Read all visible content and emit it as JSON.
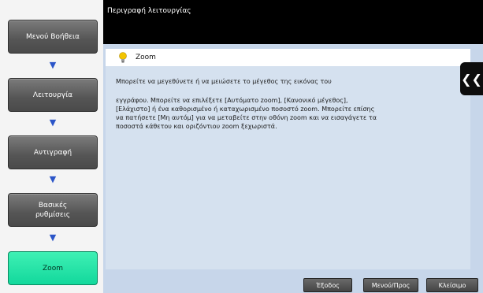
{
  "topbar": {
    "title": "Περιγραφή λειτουργίας"
  },
  "breadcrumb": {
    "items": [
      {
        "label": "Μενού Βοήθεια"
      },
      {
        "label": "Λειτουργία"
      },
      {
        "label": "Αντιγραφή"
      },
      {
        "label": "Βασικές ρυθμίσεις"
      },
      {
        "label": "Zoom"
      }
    ]
  },
  "panel": {
    "title": "Zoom",
    "paragraph1": "Μπορείτε να μεγεθύνετε ή να μειώσετε το μέγεθος της εικόνας του",
    "paragraph2": "εγγράφου. Μπορείτε να επιλέξετε [Αυτόματο zoom], [Κανονικό μέγεθος], [Ελάχιστο] ή ένα καθορισμένο ή καταχωρισμένο ποσοστό zoom. Μπορείτε επίσης να πατήσετε [Μη αυτόμ] για να μεταβείτε στην οθόνη zoom και να εισαγάγετε τα ποσοστά κάθετου και οριζόντιου zoom ξεχωριστά."
  },
  "footer": {
    "exit_label": "Έξοδος",
    "menu_label": "Μενού/Προς",
    "close_label": "Κλείσιμο"
  },
  "colors": {
    "active_crumb": "#12d89c",
    "arrow": "#2b55c8"
  }
}
